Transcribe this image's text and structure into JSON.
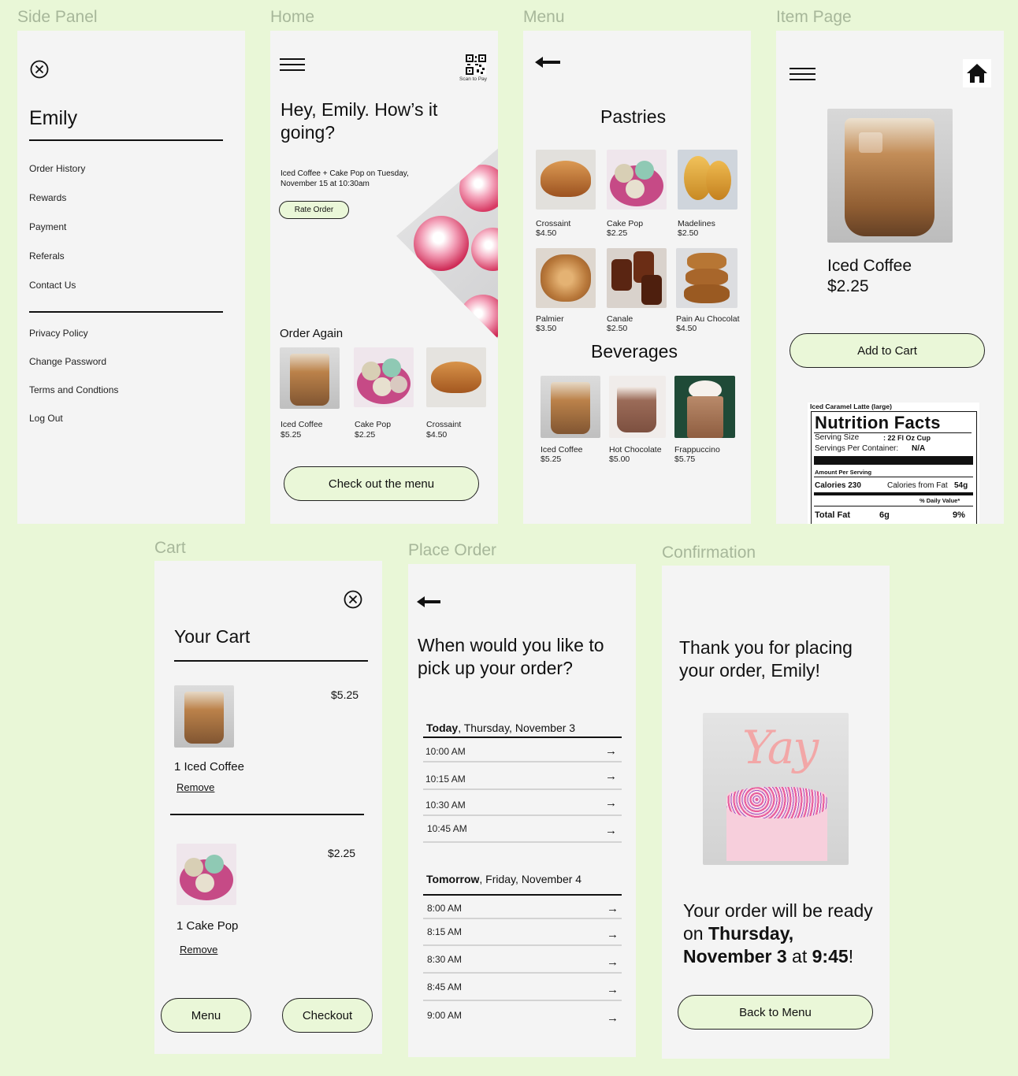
{
  "labels": {
    "side_panel": "Side Panel",
    "home": "Home",
    "menu": "Menu",
    "item_page": "Item Page",
    "cart": "Cart",
    "place_order": "Place Order",
    "confirmation": "Confirmation"
  },
  "side_panel": {
    "user_name": "Emily",
    "items": [
      "Order History",
      "Rewards",
      "Payment",
      "Referals",
      "Contact Us"
    ],
    "items2": [
      "Privacy Policy",
      "Change Password",
      "Terms and Condtions",
      "Log Out"
    ]
  },
  "home": {
    "scan_label": "Scan to Pay",
    "greeting": "Hey, Emily. How’s it going?",
    "last_order": "Iced Coffee + Cake Pop on Tuesday, November 15 at 10:30am",
    "rate_button": "Rate Order",
    "order_again_title": "Order Again",
    "order_again": [
      {
        "name": "Iced Coffee",
        "price": "$5.25"
      },
      {
        "name": "Cake Pop",
        "price": "$2.25"
      },
      {
        "name": "Crossaint",
        "price": "$4.50"
      }
    ],
    "menu_button": "Check out the menu"
  },
  "menu": {
    "pastries_title": "Pastries",
    "pastries": [
      {
        "name": "Crossaint",
        "price": "$4.50"
      },
      {
        "name": "Cake Pop",
        "price": "$2.25"
      },
      {
        "name": "Madelines",
        "price": "$2.50"
      },
      {
        "name": "Palmier",
        "price": "$3.50"
      },
      {
        "name": "Canale",
        "price": "$2.50"
      },
      {
        "name": "Pain Au Chocolat",
        "price": "$4.50"
      }
    ],
    "beverages_title": "Beverages",
    "beverages": [
      {
        "name": "Iced Coffee",
        "price": "$5.25"
      },
      {
        "name": "Hot Chocolate",
        "price": "$5.00"
      },
      {
        "name": "Frappuccino",
        "price": "$5.75"
      }
    ]
  },
  "item_page": {
    "name": "Iced Coffee",
    "price": "$2.25",
    "add_button": "Add to Cart",
    "nutrition": {
      "product": "Iced Caramel Latte (large)",
      "title": "Nutrition Facts",
      "serving_size_label": "Serving Size",
      "serving_size": ": 22 Fl Oz Cup",
      "servings_label": "Servings Per Container:",
      "servings": "N/A",
      "amount_label": "Amount Per Serving",
      "calories_label": "Calories 230",
      "calories_fat_label": "Calories from Fat",
      "calories_fat": "54g",
      "daily_value": "% Daily Value*",
      "total_fat_label": "Total Fat",
      "total_fat": "6g",
      "total_fat_pct": "9%"
    }
  },
  "cart": {
    "title": "Your Cart",
    "items": [
      {
        "qty_name": "1 Iced Coffee",
        "price": "$5.25",
        "remove": "Remove"
      },
      {
        "qty_name": "1 Cake Pop",
        "price": "$2.25",
        "remove": "Remove"
      }
    ],
    "menu_button": "Menu",
    "checkout_button": "Checkout"
  },
  "place_order": {
    "question": "When would you like to pick up your order?",
    "today_bold": "Today",
    "today_rest": ", Thursday, November 3",
    "today_slots": [
      "10:00 AM",
      "10:15 AM",
      "10:30 AM",
      "10:45 AM"
    ],
    "tomorrow_bold": "Tomorrow",
    "tomorrow_rest": ", Friday, November 4",
    "tomorrow_slots": [
      "8:00 AM",
      "8:15 AM",
      "8:30 AM",
      "8:45 AM",
      "9:00 AM"
    ]
  },
  "confirmation": {
    "thanks": "Thank you for placing your order, Emily!",
    "yay": "Yay",
    "ready_prefix": "Your order will be ready on ",
    "ready_day": "Thursday, November 3",
    "ready_mid": " at ",
    "ready_time": "9:45",
    "ready_end": "!",
    "back_button": "Back to Menu"
  },
  "icons": {
    "close": "close-circle-icon",
    "hamburger": "hamburger-icon",
    "back": "back-arrow-icon",
    "home": "home-icon",
    "qr": "qr-code-icon",
    "slot_arrow": "right-arrow-icon"
  },
  "colors": {
    "background": "#e9f7d7",
    "panel": "#f4f4f4",
    "button_fill": "#eaf7d8",
    "label": "#a7b79a"
  }
}
